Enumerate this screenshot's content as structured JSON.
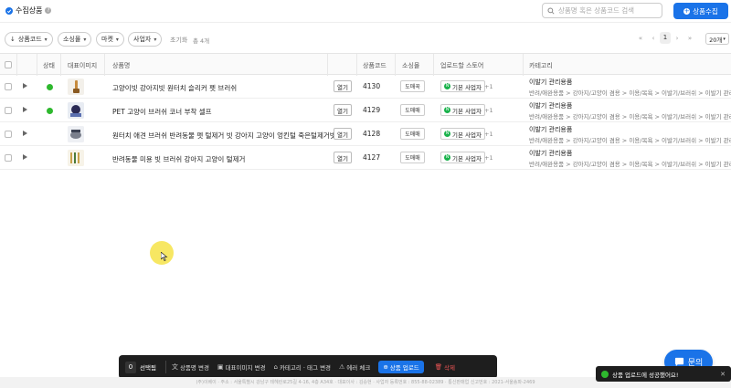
{
  "header": {
    "title": "수집상품",
    "search_placeholder": "상품명 혹은 상품코드 검색",
    "collect_button": "상품수집"
  },
  "filters": {
    "sort": "상품코드",
    "chips": [
      "소싱몰",
      "마켓",
      "사업자"
    ],
    "reset": "초기화",
    "total": "총 4개"
  },
  "pagination": {
    "current_page": "1",
    "per_page": "20개"
  },
  "table": {
    "headers": [
      "상태",
      "대표이미지",
      "상품명",
      "상품코드",
      "소싱몰",
      "업로드할 스토어",
      "카테고리"
    ],
    "rows": [
      {
        "status_ok": true,
        "name": "고양이빗 강아지빗 원터치 슬리커 펫 브러쉬",
        "open": "열기",
        "code": "4130",
        "mall": "도매꾹",
        "store": "기본 사업자",
        "store_extra": "+1",
        "category_title": "이발기 관리용품",
        "category_path": "반려/애완용품 > 강아지/고양이 겸용 > 이용/목욕 > 이발기/브러쉬 > 이발기 관리"
      },
      {
        "status_ok": true,
        "name": "PET 고양이 브러쉬 코너 부착 셀프",
        "open": "열기",
        "code": "4129",
        "mall": "도매매",
        "store": "기본 사업자",
        "store_extra": "+1",
        "category_title": "이발기 관리용품",
        "category_path": "반려/애완용품 > 강아지/고양이 겸용 > 이용/목욕 > 이발기/브러쉬 > 이발기 관리"
      },
      {
        "status_ok": false,
        "name": "원터치 애견 브러쉬 반려동물 펫 털제거 빗 강아지 고양이 엉킨털 죽은털제거빗",
        "open": "열기",
        "code": "4128",
        "mall": "도매매",
        "store": "기본 사업자",
        "store_extra": "+1",
        "category_title": "이발기 관리용품",
        "category_path": "반려/애완용품 > 강아지/고양이 겸용 > 이용/목욕 > 이발기/브러쉬 > 이발기 관리"
      },
      {
        "status_ok": false,
        "name": "반려동물 미용 빗 브러쉬 강아지 고양이 털제거",
        "open": "열기",
        "code": "4127",
        "mall": "도매매",
        "store": "기본 사업자",
        "store_extra": "+1",
        "category_title": "이발기 관리용품",
        "category_path": "반려/애완용품 > 강아지/고양이 겸용 > 이용/목욕 > 이발기/브러쉬 > 이발기 관리"
      }
    ]
  },
  "action_bar": {
    "count": "0",
    "selected": "선택됨",
    "items": [
      "상품명 변경",
      "대표이미지 변경",
      "카테고리 · 태그 변경",
      "에러 체크"
    ],
    "upload": "상품 업로드",
    "delete": "삭제"
  },
  "footer": "(주)이베이 · 주소 : 서울특별시 강남구 테헤란로25길 4-16, 4층 A34호 · 대표이사 : 김승현 · 사업자 등록번호 : 855-88-02389 · 통신판매업 신고번호 : 2021-서울송파-2469",
  "inquiry": "문의",
  "toast": "상품 업로드에 성공했어요!",
  "colors": {
    "primary": "#1a73e8",
    "success": "#2eb82e",
    "dark": "#1e1e1e"
  }
}
